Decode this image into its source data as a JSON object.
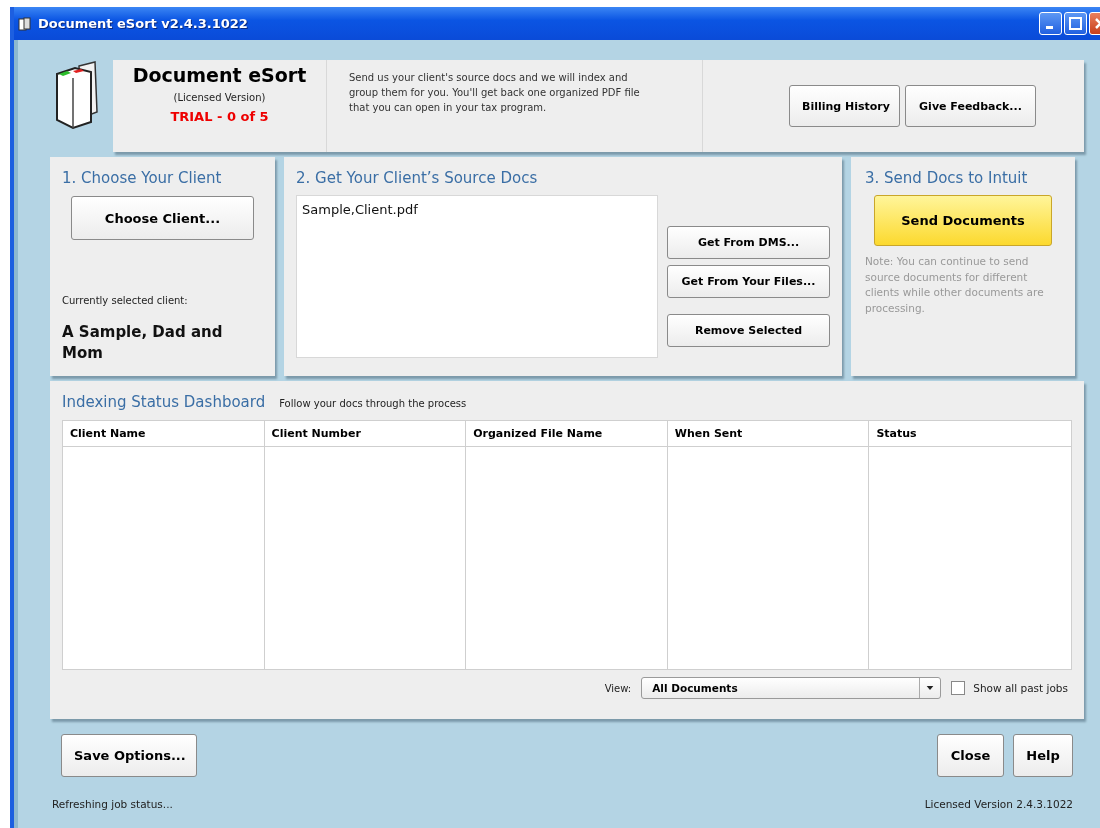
{
  "window": {
    "title": "Document eSort v2.4.3.1022"
  },
  "header": {
    "app_name": "Document eSort",
    "license": "(Licensed Version)",
    "trial": "TRIAL - 0 of 5",
    "description": "Send us your client's source docs and we will index and group them for you. You'll get back one organized PDF file that you can open in your tax program.",
    "buttons": [
      "Billing History",
      "Give Feedback..."
    ]
  },
  "step1": {
    "title": "1. Choose Your Client",
    "button": "Choose Client...",
    "selected_label": "Currently selected client:",
    "selected_client": "A Sample, Dad and Mom"
  },
  "step2": {
    "title": "2. Get Your Client’s Source Docs",
    "files": [
      "Sample,Client.pdf"
    ],
    "buttons": [
      "Get From DMS...",
      "Get From Your Files...",
      "Remove Selected"
    ]
  },
  "step3": {
    "title": "3. Send Docs to Intuit",
    "button": "Send Documents",
    "note": "Note: You can continue to send source documents for different clients while other documents are processing."
  },
  "dashboard": {
    "title": "Indexing Status Dashboard",
    "subtitle": "Follow your docs through the process",
    "table": {
      "columns": [
        "Client Name",
        "Client Number",
        "Organized File Name",
        "When Sent",
        "Status"
      ]
    },
    "view": {
      "label": "View:",
      "value": "All Documents"
    },
    "show_all_past_jobs": {
      "label": "Show all past jobs",
      "checked": false
    }
  },
  "footer": {
    "left_buttons": [
      "Save Options..."
    ],
    "right_buttons": [
      "Close",
      "Help"
    ],
    "status": "Refreshing job status...",
    "version": "Licensed Version 2.4.3.1022"
  }
}
